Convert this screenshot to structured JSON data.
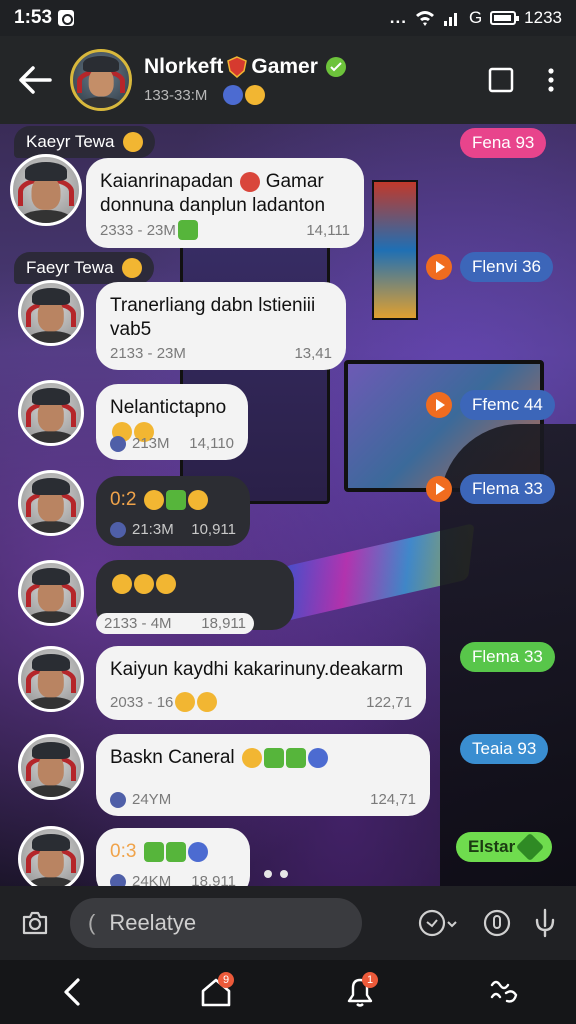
{
  "status_bar": {
    "time": "1:53",
    "dots": "...",
    "battery_text": "1233",
    "signal_label": "G"
  },
  "header": {
    "name": "Nlorkeft",
    "name_suffix": "Gamer",
    "subtitle": "133-33:M"
  },
  "messages": [
    {
      "sender": "Kaeyr Tewa",
      "text_line1": "Kaianrinapadan",
      "text_line1b": "Gamar",
      "text_line2": "donnuna danplun ladanton",
      "meta_left": "2333 - 23M",
      "meta_right": "14,111"
    },
    {
      "sender": "Faeyr Tewa",
      "text_line1": "Tranerliang dabn lstieniii",
      "text_line2": "vab5",
      "meta_left": "2133 - 23M",
      "meta_right": "13,41"
    },
    {
      "text": "Nelantictapno",
      "meta_left": "213M",
      "meta_right": "14,110"
    },
    {
      "text": "0:2",
      "meta_left": "21:3M",
      "meta_right": "10,911"
    },
    {
      "text": "",
      "meta_left": "2133 - 4M",
      "meta_right": "18,911"
    },
    {
      "text": "Kaiyun kaydhi kakarinuny.deakarm",
      "meta_left": "2033 - 16",
      "meta_right": "122,71"
    },
    {
      "text": "Baskn Caneral",
      "meta_left": "24YM",
      "meta_right": "124,71"
    },
    {
      "text": "0:3",
      "meta_left": "24KM",
      "meta_right": "18,911"
    }
  ],
  "pills": [
    {
      "label": "Fena 93",
      "color": "#e8448c"
    },
    {
      "label": "Flenvi 36",
      "color": "#3c66b9"
    },
    {
      "label": "Ffemc 44",
      "color": "#3c66b9"
    },
    {
      "label": "Flema 33",
      "color": "#3c66b9"
    },
    {
      "label": "Flema 33",
      "color": "#58c64a"
    },
    {
      "label": "Teaia 93",
      "color": "#3a8ed1"
    },
    {
      "label": "Elstar",
      "color": "#6fdc4e"
    }
  ],
  "composer": {
    "placeholder": "Reelatye",
    "caret": "("
  },
  "nav": {
    "home_badge": "9",
    "bell_badge": "1"
  },
  "icons": {
    "back": "arrow-left-icon",
    "square": "square-icon",
    "more": "more-vert-icon",
    "camera": "camera-icon",
    "sticker": "sticker-icon",
    "timer": "timer-icon",
    "mic": "mic-icon"
  }
}
